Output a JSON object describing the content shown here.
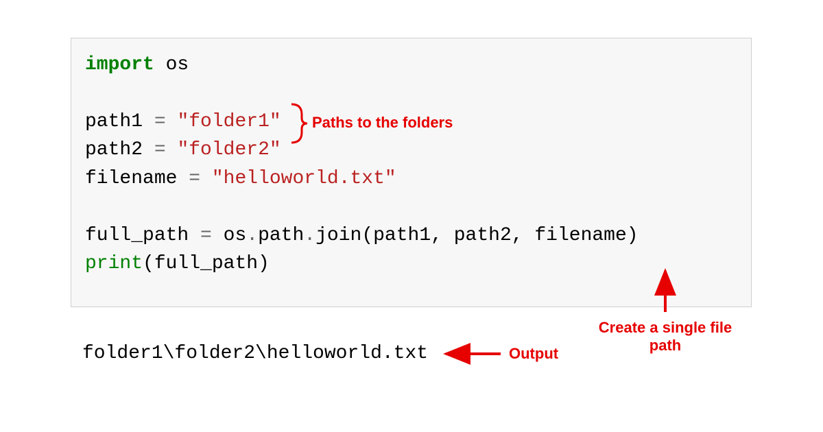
{
  "code": {
    "line1_kw": "import",
    "line1_mod": " os",
    "line3_a": "path1 ",
    "line3_op": "=",
    "line3_b": " ",
    "line3_str": "\"folder1\"",
    "line4_a": "path2 ",
    "line4_op": "=",
    "line4_b": " ",
    "line4_str": "\"folder2\"",
    "line5_a": "filename ",
    "line5_op": "=",
    "line5_b": " ",
    "line5_str": "\"helloworld.txt\"",
    "line7_a": "full_path ",
    "line7_op": "=",
    "line7_b": " os",
    "line7_op2": ".",
    "line7_c": "path",
    "line7_op3": ".",
    "line7_d": "join(path1, path2, filename)",
    "line8_fn": "print",
    "line8_rest": "(full_path)"
  },
  "output": "folder1\\folder2\\helloworld.txt",
  "annotations": {
    "paths": "Paths to the folders",
    "output": "Output",
    "create1": "Create a single file",
    "create2": "path"
  }
}
